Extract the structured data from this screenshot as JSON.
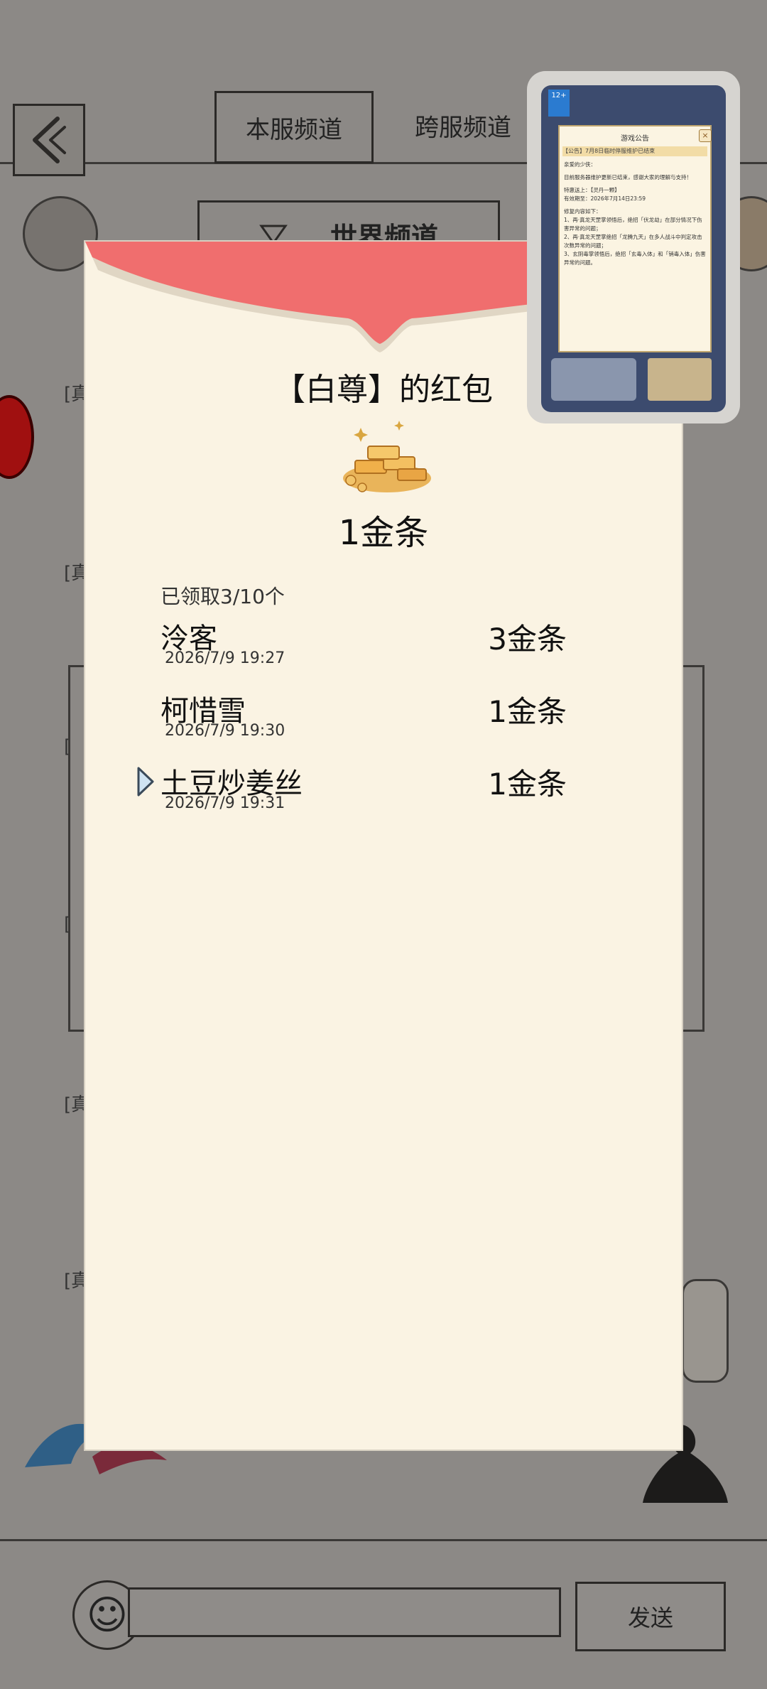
{
  "header": {
    "tabs": [
      {
        "label": "本服频道",
        "active": true
      },
      {
        "label": "跨服频道",
        "active": false
      }
    ],
    "channel_selector": "世界频道"
  },
  "background_tags": [
    "[真",
    "[真",
    "[",
    "[",
    "[真",
    "[真"
  ],
  "red_packet": {
    "title": "【白尊】的红包",
    "amount": "1金条",
    "claimed_status": "已领取3/10个",
    "records": [
      {
        "name": "泠客",
        "time": "2026/7/9 19:27",
        "amount": "3金条"
      },
      {
        "name": "柯惜雪",
        "time": "2026/7/9 19:30",
        "amount": "1金条"
      },
      {
        "name": "土豆炒姜丝",
        "time": "2026/7/9 19:31",
        "amount": "1金条",
        "is_self": true
      }
    ]
  },
  "chat_bar": {
    "input_value": "",
    "send_label": "发送"
  },
  "notice_thumbnail": {
    "title": "游戏公告",
    "rating_badge": "12+",
    "banner": "【公告】7月8日临时停服维护已结束",
    "body": [
      "亲爱的少侠：",
      "目前服务器维护更新已结束，感谢大家的理解与支持！",
      "特惠送上：【灵丹一颗】",
      "有效期至：2026年7月14日23:59",
      "修复内容如下：",
      "1、再·真龙天罡掌领悟后，绝招「伏龙劫」在部分情况下伤害异常的问题；",
      "2、再·真龙天罡掌绝招「龙腾九天」在多人战斗中判定攻击次数异常的问题；",
      "3、玄阴毒掌领悟后，绝招「玄毒入体」和「销毒入体」伤害异常的问题。"
    ]
  },
  "colors": {
    "packet_bg": "#faf3e3",
    "packet_flap": "#f06e6e",
    "overlay": "#8a8784"
  }
}
